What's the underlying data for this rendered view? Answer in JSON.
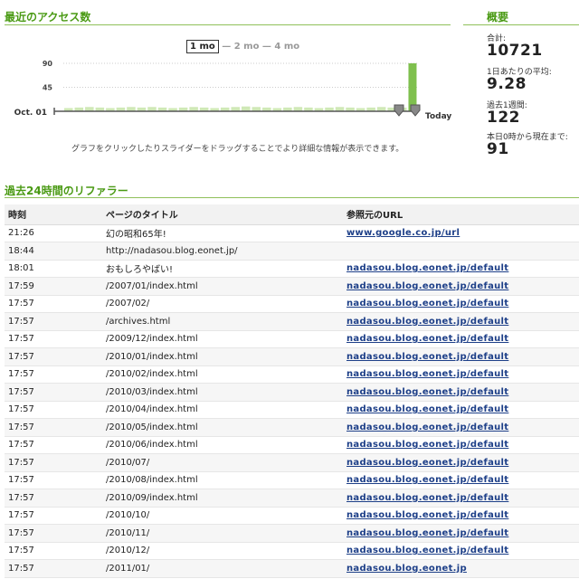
{
  "access": {
    "title": "最近のアクセス数",
    "ranges": [
      "1 mo",
      "2 mo",
      "4 mo"
    ],
    "range_sep": "—",
    "caption": "グラフをクリックしたりスライダーをドラッグすることでより詳細な情報が表示できます。"
  },
  "chart_data": {
    "type": "bar",
    "x_start_label": "Oct. 01",
    "x_end_label": "Today",
    "y_ticks": [
      45,
      90
    ],
    "ylim": [
      0,
      110
    ],
    "values": [
      6,
      7,
      8,
      7,
      6,
      7,
      8,
      7,
      8,
      7,
      6,
      7,
      8,
      7,
      6,
      7,
      8,
      9,
      8,
      7,
      6,
      7,
      8,
      7,
      6,
      7,
      8,
      7,
      6,
      7,
      8,
      7,
      7,
      90
    ],
    "colors": {
      "bar": "#cfe8b6",
      "highlight": "#7fc04e",
      "axis": "#555555",
      "grid": "#cccccc"
    }
  },
  "summary": {
    "title": "概要",
    "items": [
      {
        "label": "合計:",
        "value": "10721"
      },
      {
        "label": "1日あたりの平均:",
        "value": "9.28"
      },
      {
        "label": "過去1週間:",
        "value": "122"
      },
      {
        "label": "本日0時から現在まで:",
        "value": "91"
      }
    ]
  },
  "referrers": {
    "title": "過去24時間のリファラー",
    "headers": [
      "時刻",
      "ページのタイトル",
      "参照元のURL"
    ],
    "rows": [
      {
        "time": "21:26",
        "title": "幻の昭和65年!",
        "url": "www.google.co.jp/url"
      },
      {
        "time": "18:44",
        "title": "http://nadasou.blog.eonet.jp/",
        "url": ""
      },
      {
        "time": "18:01",
        "title": "おもしろやばい!",
        "url": "nadasou.blog.eonet.jp/default"
      },
      {
        "time": "17:59",
        "title": "/2007/01/index.html",
        "url": "nadasou.blog.eonet.jp/default"
      },
      {
        "time": "17:57",
        "title": "/2007/02/",
        "url": "nadasou.blog.eonet.jp/default"
      },
      {
        "time": "17:57",
        "title": "/archives.html",
        "url": "nadasou.blog.eonet.jp/default"
      },
      {
        "time": "17:57",
        "title": "/2009/12/index.html",
        "url": "nadasou.blog.eonet.jp/default"
      },
      {
        "time": "17:57",
        "title": "/2010/01/index.html",
        "url": "nadasou.blog.eonet.jp/default"
      },
      {
        "time": "17:57",
        "title": "/2010/02/index.html",
        "url": "nadasou.blog.eonet.jp/default"
      },
      {
        "time": "17:57",
        "title": "/2010/03/index.html",
        "url": "nadasou.blog.eonet.jp/default"
      },
      {
        "time": "17:57",
        "title": "/2010/04/index.html",
        "url": "nadasou.blog.eonet.jp/default"
      },
      {
        "time": "17:57",
        "title": "/2010/05/index.html",
        "url": "nadasou.blog.eonet.jp/default"
      },
      {
        "time": "17:57",
        "title": "/2010/06/index.html",
        "url": "nadasou.blog.eonet.jp/default"
      },
      {
        "time": "17:57",
        "title": "/2010/07/",
        "url": "nadasou.blog.eonet.jp/default"
      },
      {
        "time": "17:57",
        "title": "/2010/08/index.html",
        "url": "nadasou.blog.eonet.jp/default"
      },
      {
        "time": "17:57",
        "title": "/2010/09/index.html",
        "url": "nadasou.blog.eonet.jp/default"
      },
      {
        "time": "17:57",
        "title": "/2010/10/",
        "url": "nadasou.blog.eonet.jp/default"
      },
      {
        "time": "17:57",
        "title": "/2010/11/",
        "url": "nadasou.blog.eonet.jp/default"
      },
      {
        "time": "17:57",
        "title": "/2010/12/",
        "url": "nadasou.blog.eonet.jp/default"
      },
      {
        "time": "17:57",
        "title": "/2011/01/",
        "url": "nadasou.blog.eonet.jp"
      }
    ]
  }
}
